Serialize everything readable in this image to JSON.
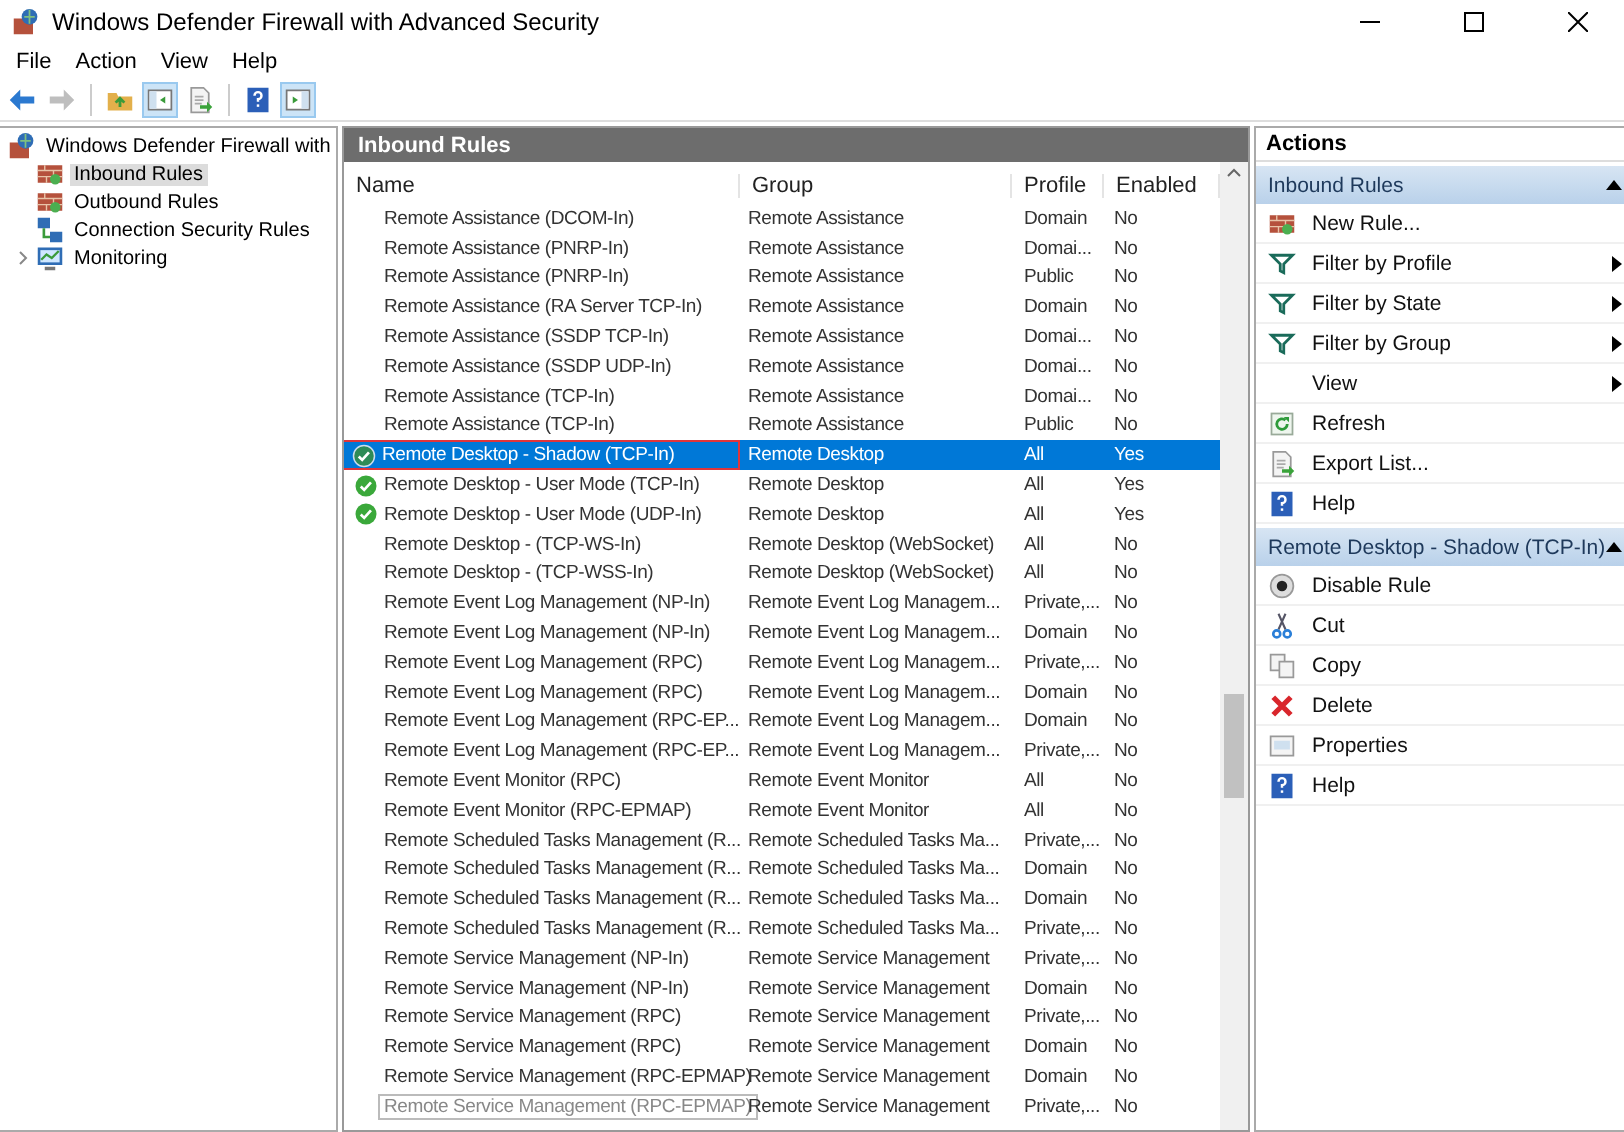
{
  "window": {
    "title": "Windows Defender Firewall with Advanced Security"
  },
  "menu": [
    "File",
    "Action",
    "View",
    "Help"
  ],
  "toolbar": [
    {
      "kind": "back",
      "disabled": false,
      "pressed": false
    },
    {
      "kind": "forward",
      "disabled": true,
      "pressed": false
    },
    {
      "kind": "up",
      "disabled": false,
      "pressed": false
    },
    {
      "kind": "tree",
      "disabled": false,
      "pressed": true
    },
    {
      "kind": "export",
      "disabled": false,
      "pressed": false
    },
    {
      "kind": "help",
      "disabled": false,
      "pressed": false
    },
    {
      "kind": "pane",
      "disabled": false,
      "pressed": true
    }
  ],
  "tree": {
    "label": "Windows Defender Firewall with",
    "children": [
      {
        "label": "Inbound Rules",
        "kind": "inbound",
        "selected": true,
        "expandable": false
      },
      {
        "label": "Outbound Rules",
        "kind": "outbound",
        "selected": false,
        "expandable": false
      },
      {
        "label": "Connection Security Rules",
        "kind": "connection",
        "selected": false,
        "expandable": false
      },
      {
        "label": "Monitoring",
        "kind": "monitor",
        "selected": false,
        "expandable": true
      }
    ]
  },
  "rules_panel": {
    "title": "Inbound Rules",
    "columns": [
      "Name",
      "Group",
      "Profile",
      "Enabled"
    ],
    "rows": [
      {
        "name": "Remote Assistance (DCOM-In)",
        "group": "Remote Assistance",
        "profile": "Domain",
        "enabled": "No",
        "active": false,
        "selected": false,
        "highlighted": false,
        "focused": false
      },
      {
        "name": "Remote Assistance (PNRP-In)",
        "group": "Remote Assistance",
        "profile": "Domai...",
        "enabled": "No",
        "active": false,
        "selected": false,
        "highlighted": false,
        "focused": false
      },
      {
        "name": "Remote Assistance (PNRP-In)",
        "group": "Remote Assistance",
        "profile": "Public",
        "enabled": "No",
        "active": false,
        "selected": false,
        "highlighted": false,
        "focused": false
      },
      {
        "name": "Remote Assistance (RA Server TCP-In)",
        "group": "Remote Assistance",
        "profile": "Domain",
        "enabled": "No",
        "active": false,
        "selected": false,
        "highlighted": false,
        "focused": false
      },
      {
        "name": "Remote Assistance (SSDP TCP-In)",
        "group": "Remote Assistance",
        "profile": "Domai...",
        "enabled": "No",
        "active": false,
        "selected": false,
        "highlighted": false,
        "focused": false
      },
      {
        "name": "Remote Assistance (SSDP UDP-In)",
        "group": "Remote Assistance",
        "profile": "Domai...",
        "enabled": "No",
        "active": false,
        "selected": false,
        "highlighted": false,
        "focused": false
      },
      {
        "name": "Remote Assistance (TCP-In)",
        "group": "Remote Assistance",
        "profile": "Domai...",
        "enabled": "No",
        "active": false,
        "selected": false,
        "highlighted": false,
        "focused": false
      },
      {
        "name": "Remote Assistance (TCP-In)",
        "group": "Remote Assistance",
        "profile": "Public",
        "enabled": "No",
        "active": false,
        "selected": false,
        "highlighted": false,
        "focused": false
      },
      {
        "name": "Remote Desktop - Shadow (TCP-In)",
        "group": "Remote Desktop",
        "profile": "All",
        "enabled": "Yes",
        "active": true,
        "selected": true,
        "highlighted": true,
        "focused": false
      },
      {
        "name": "Remote Desktop - User Mode (TCP-In)",
        "group": "Remote Desktop",
        "profile": "All",
        "enabled": "Yes",
        "active": true,
        "selected": false,
        "highlighted": false,
        "focused": false
      },
      {
        "name": "Remote Desktop - User Mode (UDP-In)",
        "group": "Remote Desktop",
        "profile": "All",
        "enabled": "Yes",
        "active": true,
        "selected": false,
        "highlighted": false,
        "focused": false
      },
      {
        "name": "Remote Desktop - (TCP-WS-In)",
        "group": "Remote Desktop (WebSocket)",
        "profile": "All",
        "enabled": "No",
        "active": false,
        "selected": false,
        "highlighted": false,
        "focused": false
      },
      {
        "name": "Remote Desktop - (TCP-WSS-In)",
        "group": "Remote Desktop (WebSocket)",
        "profile": "All",
        "enabled": "No",
        "active": false,
        "selected": false,
        "highlighted": false,
        "focused": false
      },
      {
        "name": "Remote Event Log Management (NP-In)",
        "group": "Remote Event Log Managem...",
        "profile": "Private,...",
        "enabled": "No",
        "active": false,
        "selected": false,
        "highlighted": false,
        "focused": false
      },
      {
        "name": "Remote Event Log Management (NP-In)",
        "group": "Remote Event Log Managem...",
        "profile": "Domain",
        "enabled": "No",
        "active": false,
        "selected": false,
        "highlighted": false,
        "focused": false
      },
      {
        "name": "Remote Event Log Management (RPC)",
        "group": "Remote Event Log Managem...",
        "profile": "Private,...",
        "enabled": "No",
        "active": false,
        "selected": false,
        "highlighted": false,
        "focused": false
      },
      {
        "name": "Remote Event Log Management (RPC)",
        "group": "Remote Event Log Managem...",
        "profile": "Domain",
        "enabled": "No",
        "active": false,
        "selected": false,
        "highlighted": false,
        "focused": false
      },
      {
        "name": "Remote Event Log Management (RPC-EP...",
        "group": "Remote Event Log Managem...",
        "profile": "Domain",
        "enabled": "No",
        "active": false,
        "selected": false,
        "highlighted": false,
        "focused": false
      },
      {
        "name": "Remote Event Log Management (RPC-EP...",
        "group": "Remote Event Log Managem...",
        "profile": "Private,...",
        "enabled": "No",
        "active": false,
        "selected": false,
        "highlighted": false,
        "focused": false
      },
      {
        "name": "Remote Event Monitor (RPC)",
        "group": "Remote Event Monitor",
        "profile": "All",
        "enabled": "No",
        "active": false,
        "selected": false,
        "highlighted": false,
        "focused": false
      },
      {
        "name": "Remote Event Monitor (RPC-EPMAP)",
        "group": "Remote Event Monitor",
        "profile": "All",
        "enabled": "No",
        "active": false,
        "selected": false,
        "highlighted": false,
        "focused": false
      },
      {
        "name": "Remote Scheduled Tasks Management (R...",
        "group": "Remote Scheduled Tasks Ma...",
        "profile": "Private,...",
        "enabled": "No",
        "active": false,
        "selected": false,
        "highlighted": false,
        "focused": false
      },
      {
        "name": "Remote Scheduled Tasks Management (R...",
        "group": "Remote Scheduled Tasks Ma...",
        "profile": "Domain",
        "enabled": "No",
        "active": false,
        "selected": false,
        "highlighted": false,
        "focused": false
      },
      {
        "name": "Remote Scheduled Tasks Management (R...",
        "group": "Remote Scheduled Tasks Ma...",
        "profile": "Domain",
        "enabled": "No",
        "active": false,
        "selected": false,
        "highlighted": false,
        "focused": false
      },
      {
        "name": "Remote Scheduled Tasks Management (R...",
        "group": "Remote Scheduled Tasks Ma...",
        "profile": "Private,...",
        "enabled": "No",
        "active": false,
        "selected": false,
        "highlighted": false,
        "focused": false
      },
      {
        "name": "Remote Service Management (NP-In)",
        "group": "Remote Service Management",
        "profile": "Private,...",
        "enabled": "No",
        "active": false,
        "selected": false,
        "highlighted": false,
        "focused": false
      },
      {
        "name": "Remote Service Management (NP-In)",
        "group": "Remote Service Management",
        "profile": "Domain",
        "enabled": "No",
        "active": false,
        "selected": false,
        "highlighted": false,
        "focused": false
      },
      {
        "name": "Remote Service Management (RPC)",
        "group": "Remote Service Management",
        "profile": "Private,...",
        "enabled": "No",
        "active": false,
        "selected": false,
        "highlighted": false,
        "focused": false
      },
      {
        "name": "Remote Service Management (RPC)",
        "group": "Remote Service Management",
        "profile": "Domain",
        "enabled": "No",
        "active": false,
        "selected": false,
        "highlighted": false,
        "focused": false
      },
      {
        "name": "Remote Service Management (RPC-EPMAP)",
        "group": "Remote Service Management",
        "profile": "Domain",
        "enabled": "No",
        "active": false,
        "selected": false,
        "highlighted": false,
        "focused": false
      },
      {
        "name": "Remote Service Management (RPC-EPMAP)",
        "group": "Remote Service Management",
        "profile": "Private,...",
        "enabled": "No",
        "active": false,
        "selected": false,
        "highlighted": false,
        "focused": true
      }
    ]
  },
  "actions": {
    "title": "Actions",
    "sections": [
      {
        "title": "Inbound Rules",
        "expanded": true,
        "items": [
          {
            "label": "New Rule...",
            "kind": "newrule",
            "submenu": false
          },
          {
            "label": "Filter by Profile",
            "kind": "filter",
            "submenu": true
          },
          {
            "label": "Filter by State",
            "kind": "filter",
            "submenu": true
          },
          {
            "label": "Filter by Group",
            "kind": "filter",
            "submenu": true
          },
          {
            "label": "View",
            "kind": "none",
            "submenu": true
          },
          {
            "label": "Refresh",
            "kind": "refresh",
            "submenu": false
          },
          {
            "label": "Export List...",
            "kind": "export",
            "submenu": false
          },
          {
            "label": "Help",
            "kind": "help",
            "submenu": false
          }
        ]
      },
      {
        "title": "Remote Desktop - Shadow (TCP-In)",
        "expanded": true,
        "items": [
          {
            "label": "Disable Rule",
            "kind": "disable",
            "submenu": false
          },
          {
            "label": "Cut",
            "kind": "cut",
            "submenu": false
          },
          {
            "label": "Copy",
            "kind": "copy",
            "submenu": false
          },
          {
            "label": "Delete",
            "kind": "delete",
            "submenu": false
          },
          {
            "label": "Properties",
            "kind": "properties",
            "submenu": false
          },
          {
            "label": "Help",
            "kind": "help",
            "submenu": false
          }
        ]
      }
    ]
  }
}
